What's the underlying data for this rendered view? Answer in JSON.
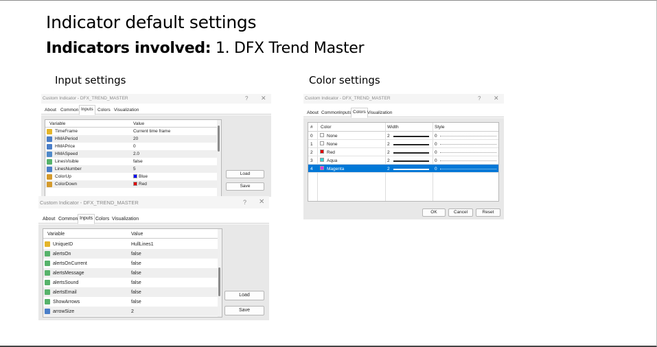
{
  "slide": {
    "title": "Indicator default settings",
    "subtitle_bold": "Indicators involved:",
    "subtitle_rest": "1. DFX Trend Master",
    "input_settings_label": "Input settings",
    "color_settings_label": "Color settings"
  },
  "colors": {
    "selection": "#0078d7",
    "blue": "#0000ff",
    "red": "#e00000",
    "aqua": "#39d6d6",
    "magenta": "#e034e0"
  },
  "dialog_common": {
    "title": "Custom Indicator - DFX_TREND_MASTER",
    "help": "?",
    "close": "✕",
    "tabs": [
      "About",
      "Common",
      "Inputs",
      "Colors",
      "Visualization"
    ],
    "col_variable": "Variable",
    "col_value": "Value",
    "load": "Load",
    "save": "Save"
  },
  "inputs_dialog_1": {
    "rows": [
      {
        "icon": "abc",
        "name": "TimeFrame",
        "value": "Current time frame"
      },
      {
        "icon": "num",
        "name": "HMAPeriod",
        "value": "20"
      },
      {
        "icon": "num",
        "name": "HMAPrice",
        "value": "0"
      },
      {
        "icon": "dbl",
        "name": "HMASpeed",
        "value": "2.0"
      },
      {
        "icon": "bool",
        "name": "LinesVisible",
        "value": "false"
      },
      {
        "icon": "num",
        "name": "LinesNumber",
        "value": "5"
      },
      {
        "icon": "col",
        "name": "ColorUp",
        "value": "Blue",
        "swatch": "#0000ff"
      },
      {
        "icon": "col",
        "name": "ColorDown",
        "value": "Red",
        "swatch": "#e00000"
      }
    ]
  },
  "inputs_dialog_2": {
    "rows": [
      {
        "icon": "abc",
        "name": "UniqueID",
        "value": "HullLines1"
      },
      {
        "icon": "bool",
        "name": "alertsOn",
        "value": "false"
      },
      {
        "icon": "bool",
        "name": "alertsOnCurrent",
        "value": "false"
      },
      {
        "icon": "bool",
        "name": "alertsMessage",
        "value": "false"
      },
      {
        "icon": "bool",
        "name": "alertsSound",
        "value": "false"
      },
      {
        "icon": "bool",
        "name": "alertsEmail",
        "value": "false"
      },
      {
        "icon": "bool",
        "name": "ShowArrows",
        "value": "false"
      },
      {
        "icon": "num",
        "name": "arrowSize",
        "value": "2"
      }
    ]
  },
  "colors_dialog": {
    "col_hash": "#",
    "col_color": "Color",
    "col_width": "Width",
    "col_style": "Style",
    "ok": "OK",
    "cancel": "Cancel",
    "reset": "Reset",
    "rows": [
      {
        "index": "0",
        "color": "None",
        "swatch": "#ffffff",
        "width": "2",
        "style": "0"
      },
      {
        "index": "1",
        "color": "None",
        "swatch": "#ffffff",
        "width": "2",
        "style": "0"
      },
      {
        "index": "2",
        "color": "Red",
        "swatch": "#e00000",
        "width": "2",
        "style": "0"
      },
      {
        "index": "3",
        "color": "Aqua",
        "swatch": "#39d6d6",
        "width": "2",
        "style": "0"
      },
      {
        "index": "4",
        "color": "Magenta",
        "swatch": "#e034e0",
        "width": "2",
        "style": "0",
        "selected": true
      }
    ]
  }
}
